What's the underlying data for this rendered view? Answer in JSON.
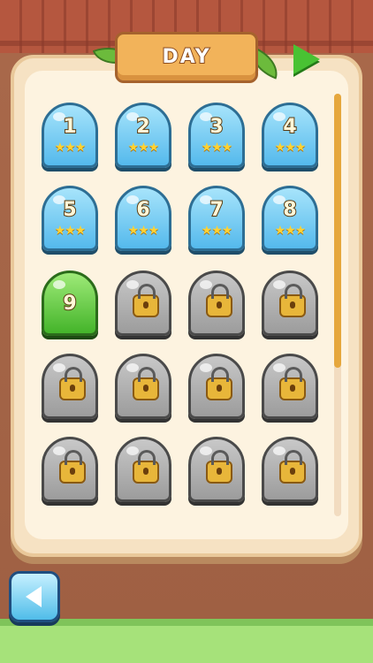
{
  "header": {
    "title": "DAY",
    "next_icon": "play-arrow-icon"
  },
  "levels": [
    {
      "number": "1",
      "state": "open",
      "stars": "★★★"
    },
    {
      "number": "2",
      "state": "open",
      "stars": "★★★"
    },
    {
      "number": "3",
      "state": "open",
      "stars": "★★★"
    },
    {
      "number": "4",
      "state": "open",
      "stars": "★★★"
    },
    {
      "number": "5",
      "state": "open",
      "stars": "★★★"
    },
    {
      "number": "6",
      "state": "open",
      "stars": "★★★"
    },
    {
      "number": "7",
      "state": "open",
      "stars": "★★★"
    },
    {
      "number": "8",
      "state": "open",
      "stars": "★★★"
    },
    {
      "number": "9",
      "state": "current",
      "stars": ""
    },
    {
      "number": "",
      "state": "locked",
      "stars": ""
    },
    {
      "number": "",
      "state": "locked",
      "stars": ""
    },
    {
      "number": "",
      "state": "locked",
      "stars": ""
    },
    {
      "number": "",
      "state": "locked",
      "stars": ""
    },
    {
      "number": "",
      "state": "locked",
      "stars": ""
    },
    {
      "number": "",
      "state": "locked",
      "stars": ""
    },
    {
      "number": "",
      "state": "locked",
      "stars": ""
    },
    {
      "number": "",
      "state": "locked",
      "stars": ""
    },
    {
      "number": "",
      "state": "locked",
      "stars": ""
    },
    {
      "number": "",
      "state": "locked",
      "stars": ""
    },
    {
      "number": "",
      "state": "locked",
      "stars": ""
    }
  ],
  "footer": {
    "back_icon": "back-arrow-icon"
  },
  "colors": {
    "open": "#54b9ec",
    "current": "#44b42a",
    "locked": "#9c9c9c",
    "accent": "#f2b35a"
  }
}
